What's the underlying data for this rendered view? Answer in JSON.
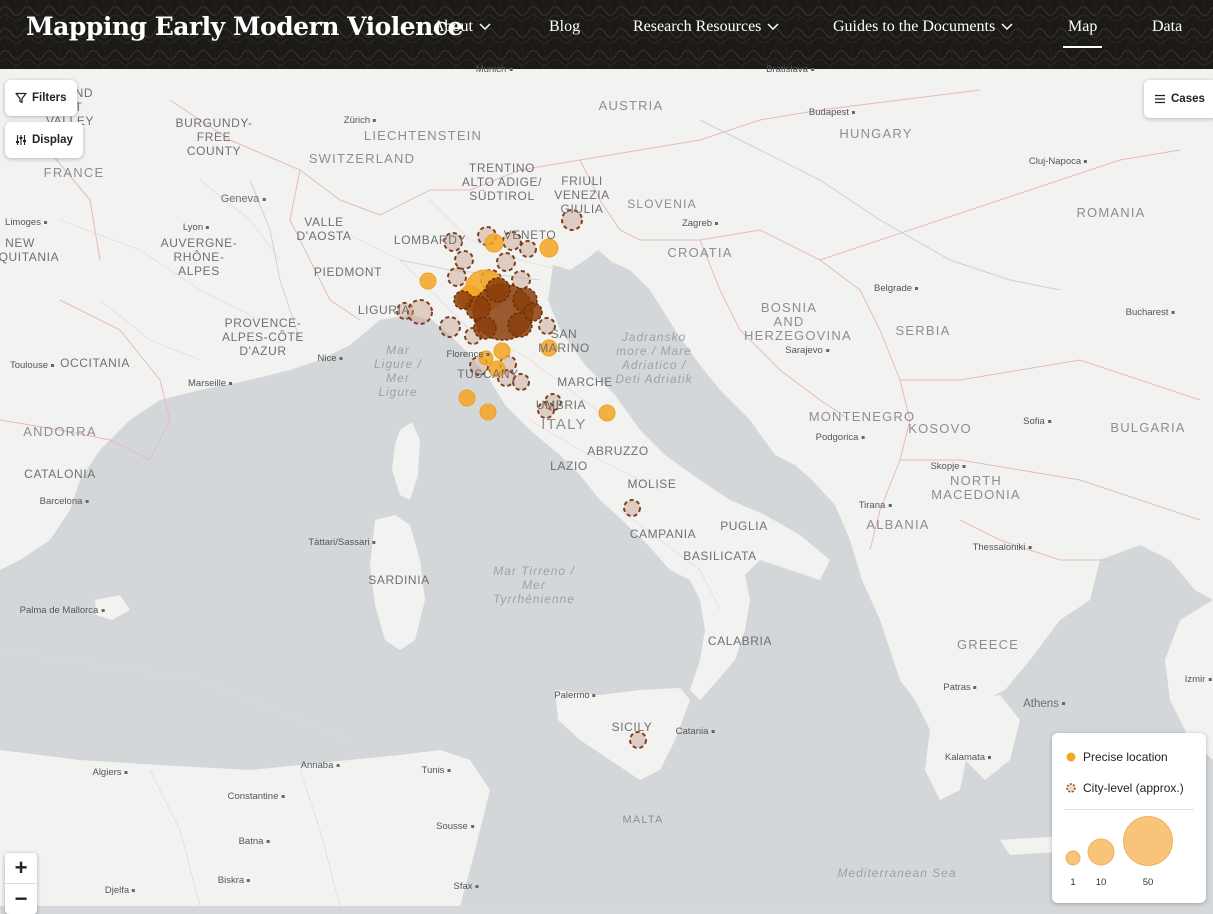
{
  "header": {
    "brand": "Mapping Early Modern Violence",
    "nav": [
      {
        "label": "About",
        "has_dropdown": true
      },
      {
        "label": "Blog",
        "has_dropdown": false
      },
      {
        "label": "Research Resources",
        "has_dropdown": true
      },
      {
        "label": "Guides to the Documents",
        "has_dropdown": true
      },
      {
        "label": "Map",
        "has_dropdown": false,
        "active": true
      },
      {
        "label": "Data",
        "has_dropdown": false
      }
    ]
  },
  "controls": {
    "filters_label": "Filters",
    "display_label": "Display",
    "cases_label": "Cases",
    "zoom_in": "+",
    "zoom_out": "−"
  },
  "legend": {
    "precise_label": "Precise location",
    "approx_label": "City-level (approx.)",
    "sizes": [
      "1",
      "10",
      "50"
    ],
    "precise_color": "#f5a623",
    "approx_color": "#8a4a1e"
  },
  "map_labels": {
    "countries": [
      "FRANCE",
      "AUSTRIA",
      "HUNGARY",
      "SWITZERLAND",
      "LIECHTENSTEIN",
      "SLOVENIA",
      "CROATIA",
      "ROMANIA",
      "BOSNIA AND HERZEGOVINA",
      "SERBIA",
      "MONTENEGRO",
      "KOSOVO",
      "BULGARIA",
      "NORTH MACEDONIA",
      "ALBANIA",
      "GREECE",
      "ITALY",
      "ANDORRA",
      "MALTA",
      "OCCITANIA",
      "CATALONIA"
    ],
    "regions": [
      "BURGUNDY-FREE COUNTY",
      "AUVERGNE-RHÔNE-ALPES",
      "PROVENCE-ALPES-CÔTE D'AZUR",
      "VALLE D'AOSTA",
      "PIEDMONT",
      "LOMBARDY",
      "TRENTINO ALTO ADIGE/ SÜDTIROL",
      "FRIULI VENEZIA GIULIA",
      "VENETO",
      "LIGURIA",
      "TUSCANY",
      "UMBRIA",
      "MARCHE",
      "SAN MARINO",
      "LAZIO",
      "ABRUZZO",
      "MOLISE",
      "CAMPANIA",
      "PUGLIA",
      "BASILICATA",
      "CALABRIA",
      "SICILY",
      "SARDINIA",
      "NEW AQUITANIA",
      "GRAND EST VALLEY"
    ],
    "seas": [
      "Mar Ligure / Mer Ligure",
      "Jadransko more / Mare Adriatico / Deti Adriatik",
      "Mar Tirreno / Mer Tyrrhénienne",
      "Mediterranean Sea"
    ],
    "cities": [
      "Munich",
      "Zürich",
      "Bratislava",
      "Budapest",
      "Cluj-Napoca",
      "Geneva",
      "Lyon",
      "Limoges",
      "Zagreb",
      "Belgrade",
      "Bucharest",
      "Sarajevo",
      "Toulouse",
      "Nice",
      "Marseille",
      "Florence",
      "Podgorica",
      "Sofia",
      "Skopje",
      "Tirana",
      "Thessaloniki",
      "Barcelona",
      "Tàttari/Sassari",
      "Palma de Mallorca",
      "Palermo",
      "Catania",
      "Patras",
      "Athens",
      "Kalamata",
      "Algiers",
      "Annaba",
      "Tunis",
      "Constantine",
      "Sousse",
      "Batna",
      "Biskra",
      "Djelfa",
      "Sfax",
      "Izmir"
    ]
  }
}
